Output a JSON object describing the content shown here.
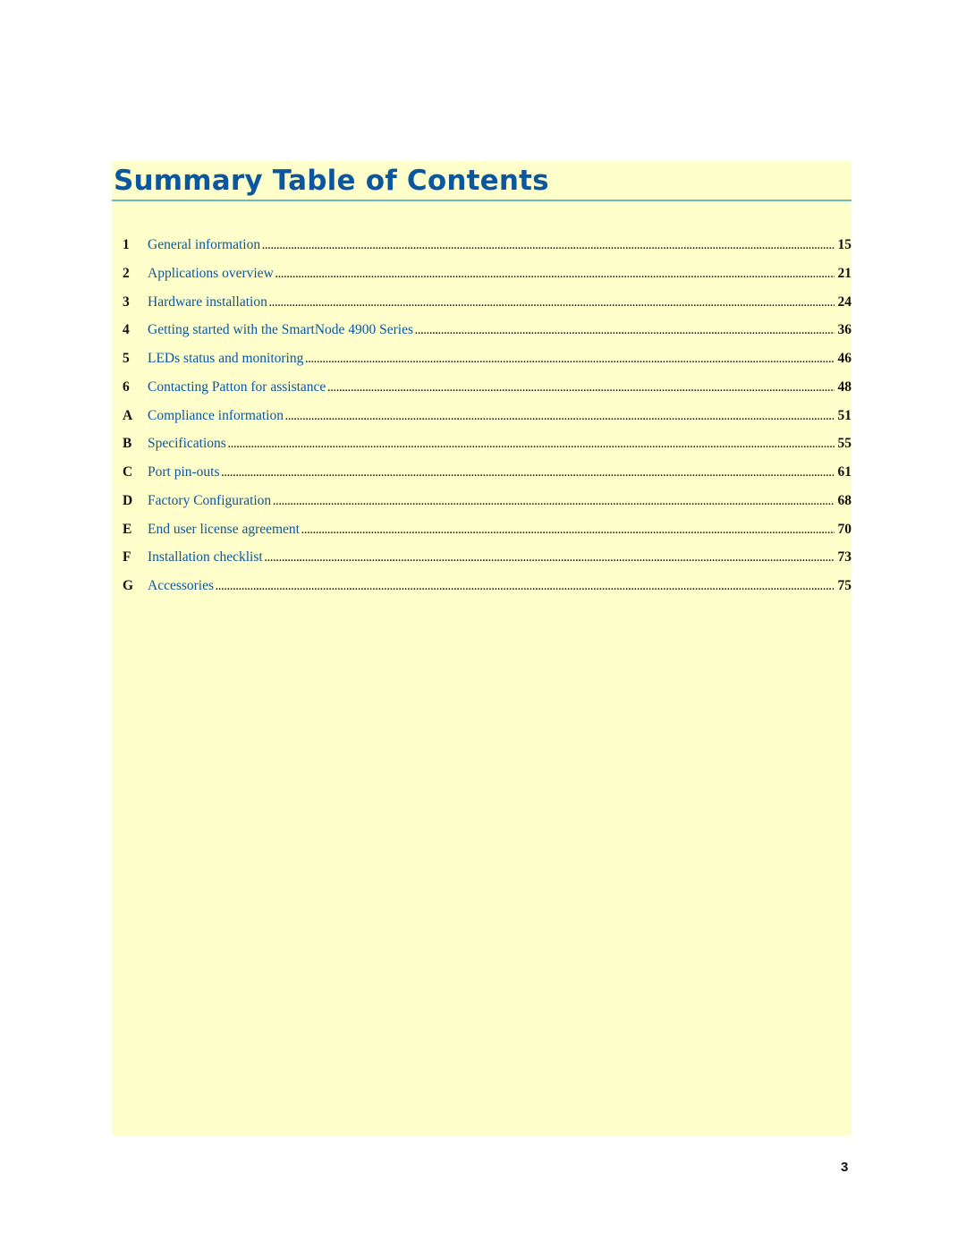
{
  "document": {
    "title": "Summary Table of Contents",
    "page_number": "3",
    "colors": {
      "panel_background": "#ffffcc",
      "title": "#0a57a0",
      "rule": "#6fb8c0",
      "entry_link": "#0a57a0",
      "entry_number": "#111111"
    }
  },
  "toc": {
    "entries": [
      {
        "number": "1",
        "label": "General information",
        "page": "15"
      },
      {
        "number": "2",
        "label": "Applications overview",
        "page": "21"
      },
      {
        "number": "3",
        "label": "Hardware installation",
        "page": "24"
      },
      {
        "number": "4",
        "label": "Getting started with the SmartNode 4900 Series",
        "page": "36"
      },
      {
        "number": "5",
        "label": "LEDs status and monitoring",
        "page": "46"
      },
      {
        "number": "6",
        "label": "Contacting Patton for assistance",
        "page": "48"
      },
      {
        "number": "A",
        "label": "Compliance information",
        "page": "51"
      },
      {
        "number": "B",
        "label": "Specifications",
        "page": "55"
      },
      {
        "number": "C",
        "label": "Port pin-outs",
        "page": "61"
      },
      {
        "number": "D",
        "label": "Factory Configuration",
        "page": "68"
      },
      {
        "number": "E",
        "label": "End user license agreement",
        "page": "70"
      },
      {
        "number": "F",
        "label": "Installation checklist",
        "page": "73"
      },
      {
        "number": "G",
        "label": "Accessories",
        "page": "75"
      }
    ]
  }
}
